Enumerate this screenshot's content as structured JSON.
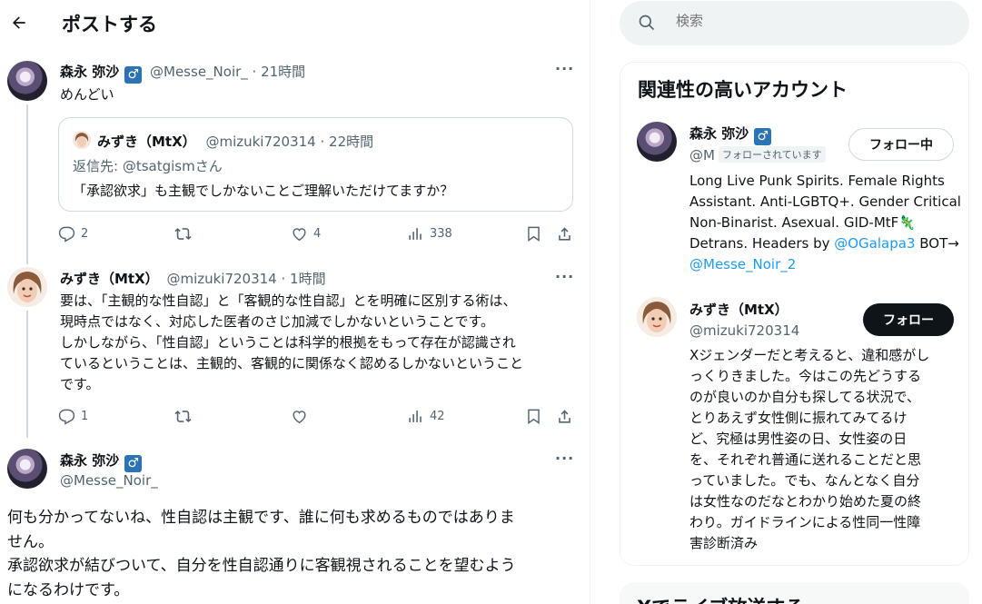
{
  "header": {
    "title": "ポストする"
  },
  "tweet1": {
    "name": "森永 弥沙",
    "badge": "♂",
    "handle_time": "@Messe_Noir_ · 21時間",
    "text": "めんどい",
    "quote": {
      "name": "みずき（MtX）",
      "handle_time": "@mizuki720314 · 22時間",
      "reply_to": "返信先: @tsatgismさん",
      "text": "「承認欲求」も主観でしかないことご理解いただけてますか？"
    },
    "stats": {
      "replies": "2",
      "likes": "4",
      "views": "338"
    }
  },
  "tweet2": {
    "name": "みずき（MtX）",
    "handle_time": "@mizuki720314 · 1時間",
    "lines": [
      "要は、「主観的な性自認」と「客観的な性自認」とを明確に区別する術は、",
      "現時点ではなく、対応した医者のさじ加減でしかないということです。",
      "しかしながら、「性自認」ということは科学的根拠をもって存在が認識され",
      "ているということは、主観的、客観的に関係なく認めるしかないということ",
      "です。"
    ],
    "stats": {
      "replies": "1",
      "views": "42"
    }
  },
  "main_post": {
    "name": "森永 弥沙",
    "badge": "♂",
    "handle": "@Messe_Noir_",
    "lines": [
      "何も分かってないね、性自認は主観です、誰に何も求めるものではありま",
      "せん。",
      "承認欲求が結びついて、自分を性自認通りに客観視されることを望むよう",
      "になるわけです。"
    ]
  },
  "search": {
    "placeholder": "検索"
  },
  "related": {
    "title": "関連性の高いアカウント",
    "account1": {
      "name": "森永 弥沙",
      "badge": "♂",
      "handle": "@M",
      "follows_you": "フォローされています",
      "button": "フォロー中",
      "bio_lines": [
        "Long Live Punk Spirits. Female Rights",
        "Assistant. Anti-LGBTQ+. Gender Critical",
        "Non-Binarist. Asexual. GID-MtF🦎"
      ],
      "bio_l4_pre": "Detrans. Headers by ",
      "bio_l4_link": "@OGalapa3",
      "bio_l4_post": " BOT→",
      "bio_l5_link": "@Messe_Noir_2"
    },
    "account2": {
      "name": "みずき（MtX）",
      "handle": "@mizuki720314",
      "button": "フォロー",
      "bio_lines": [
        "Xジェンダーだと考えると、違和感がし",
        "っくりきました。今はこの先どうする",
        "のが良いのか自分も探してる状況で、",
        "とりあえず女性側に振れてみてるけ",
        "ど、究極は男性姿の日、女性姿の日",
        "を、それぞれ普通に送れることだと思",
        "っていました。でも、なんとなく自分",
        "は女性なのだなとわかり始めた夏の終",
        "わり。ガイドラインによる性同一性障",
        "害診断済み"
      ]
    }
  },
  "live": {
    "title": "Xでライブ放送する"
  }
}
